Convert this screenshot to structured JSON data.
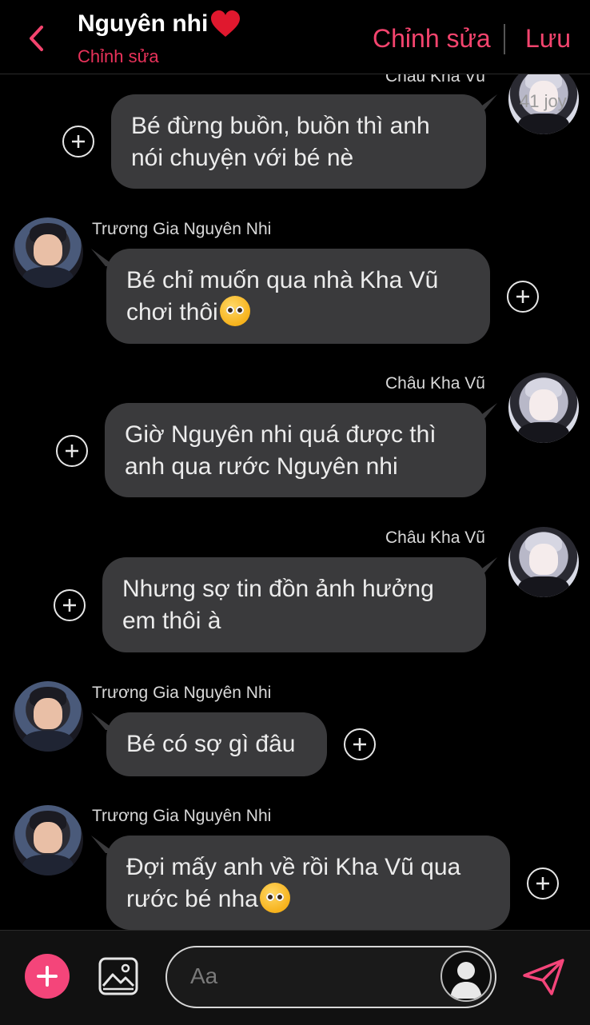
{
  "header": {
    "title": "Nguyên nhi",
    "subtitle": "Chỉnh sửa",
    "edit_label": "Chỉnh sửa",
    "save_label": "Lưu",
    "accent_color": "#f4446e",
    "heart_icon": "red-heart-emoji"
  },
  "top_partial": {
    "sender": "Châu Kha Vũ",
    "watermark": "41 joy"
  },
  "messages": [
    {
      "sender": "Châu Kha Vũ",
      "side": "right",
      "lines": [
        "Bé đừng buồn, buồn thì anh",
        "nói chuyện với bé nè"
      ]
    },
    {
      "sender": "Trương Gia Nguyên Nhi",
      "side": "left",
      "lines": [
        "Bé chỉ muốn qua nhà Kha Vũ",
        "chơi thôi"
      ],
      "emoji": "pleading-face"
    },
    {
      "sender": "Châu Kha Vũ",
      "side": "right",
      "lines": [
        "Giờ Nguyên nhi quá được thì",
        "anh qua rước Nguyên nhi"
      ]
    },
    {
      "sender": "Châu Kha Vũ",
      "side": "right",
      "lines": [
        "Nhưng sợ tin đồn ảnh hưởng",
        "em thôi à"
      ]
    },
    {
      "sender": "Trương Gia Nguyên Nhi",
      "side": "left",
      "lines": [
        "Bé có sợ gì đâu"
      ]
    },
    {
      "sender": "Trương Gia Nguyên Nhi",
      "side": "left",
      "lines": [
        "Đợi mấy anh về rồi Kha Vũ qua",
        "rước bé nha"
      ],
      "emoji": "pleading-face"
    }
  ],
  "composer": {
    "placeholder": "Aa",
    "add_icon": "plus-icon",
    "image_icon": "image-icon",
    "send_icon": "send-icon"
  }
}
